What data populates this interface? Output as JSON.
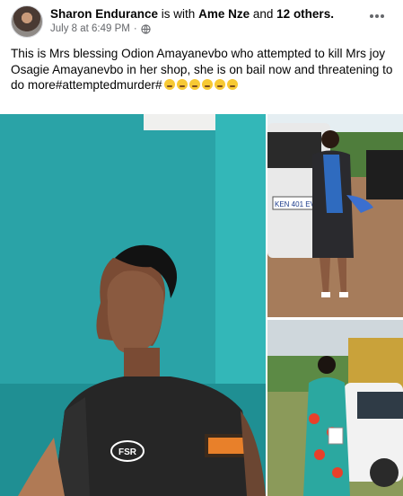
{
  "post": {
    "author": "Sharon Endurance",
    "with_text": "is with",
    "tagged": "Ame Nze",
    "and_text": "and",
    "others": "12 others.",
    "timestamp": "July 8 at 6:49 PM",
    "separator": "·",
    "text": "This is Mrs blessing Odion Amayanevbo who attempted to kill Mrs joy Osagie Amayanevbo  in her shop, she is on bail now and threatening to do more#attemptedmurder#"
  },
  "icons": {
    "avatar": "avatar",
    "globe": "globe-icon",
    "more": "more-options-icon"
  },
  "photos": {
    "main_shirt_text": "FSR",
    "car_plate": "KEN 401 EV"
  },
  "colors": {
    "link": "#050505",
    "meta": "#65676b",
    "teal_wall": "#2aa3a7"
  }
}
